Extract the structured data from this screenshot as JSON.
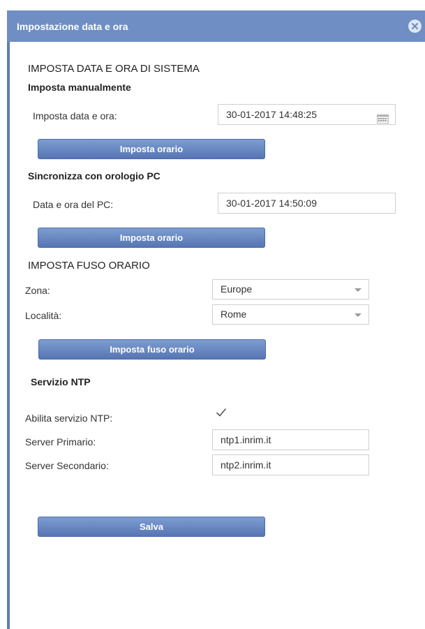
{
  "dialog": {
    "title": "Impostazione data e ora"
  },
  "icons": {
    "close": "close-circle-icon",
    "calendar": "calendar-icon",
    "dropdown": "chevron-down-icon",
    "checkbox": "checkmark-icon"
  },
  "colors": {
    "titlebar": "#6f8ec3",
    "button": "#5f7fb6",
    "border": "#5f7fb6"
  },
  "system_time": {
    "heading": "IMPOSTA DATA E ORA DI SISTEMA",
    "manual": {
      "heading": "Imposta manualmente",
      "label": "Imposta data e ora:",
      "value": "30-01-2017 14:48:25",
      "button": "Imposta orario"
    },
    "pc_sync": {
      "heading": "Sincronizza con orologio PC",
      "label": "Data e ora del PC:",
      "value": "30-01-2017 14:50:09",
      "button": "Imposta orario"
    }
  },
  "timezone": {
    "heading": "IMPOSTA FUSO ORARIO",
    "zone_label": "Zona:",
    "zone_value": "Europe",
    "locality_label": "Località:",
    "locality_value": "Rome",
    "button": "Imposta fuso orario"
  },
  "ntp": {
    "heading": "Servizio NTP",
    "enable_label": "Abilita servizio NTP:",
    "enabled": true,
    "primary_label": "Server Primario:",
    "primary_value": "ntp1.inrim.it",
    "secondary_label": "Server Secondario:",
    "secondary_value": "ntp2.inrim.it"
  },
  "save_button": "Salva"
}
